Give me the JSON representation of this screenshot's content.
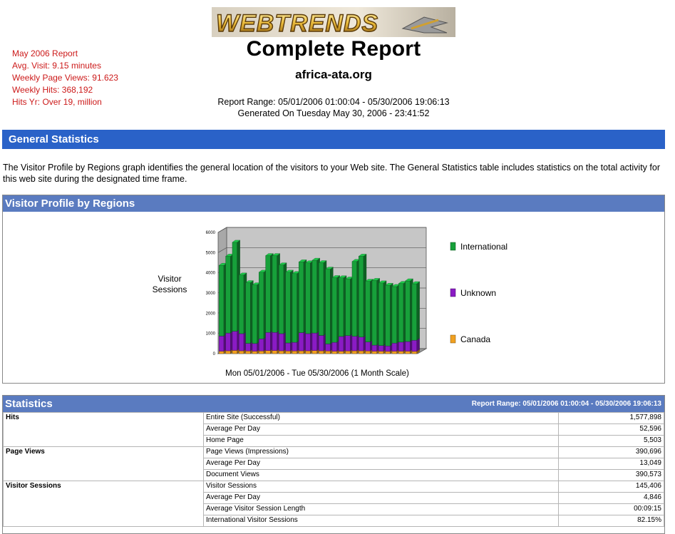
{
  "header": {
    "logo_text": "WEBTRENDS",
    "title": "Complete Report",
    "domain": "africa-ata.org",
    "report_range": "Report Range: 05/01/2006 01:00:04 - 05/30/2006 19:06:13",
    "generated_on": "Generated On Tuesday May 30, 2006 - 23:41:52"
  },
  "side_notes": [
    "May 2006 Report",
    "Avg. Visit: 9.15 minutes",
    "Weekly Page Views: 91.623",
    "Weekly Hits: 368,192",
    "Hits Yr: Over 19, million"
  ],
  "general": {
    "title": "General Statistics",
    "intro": "The Visitor Profile by Regions graph identifies the general location of the visitors to your Web site. The General Statistics table includes statistics on the total activity for this web site during the designated time frame."
  },
  "chart_section": {
    "title": "Visitor Profile by Regions"
  },
  "chart_data": {
    "type": "bar",
    "stacked": true,
    "three_d": true,
    "ylabel": "Visitor Sessions",
    "xlabel": "Mon 05/01/2006 - Tue 05/30/2006 (1 Month Scale)",
    "ylim": [
      0,
      6000
    ],
    "yticks": [
      "0",
      "1000",
      "2000",
      "3000",
      "4000",
      "5000",
      "6000"
    ],
    "grid": true,
    "legend_position": "right",
    "series": [
      {
        "name": "International",
        "color": "#17a03a",
        "values": [
          3500,
          3800,
          4400,
          2900,
          3000,
          2900,
          3300,
          3800,
          3800,
          3400,
          3500,
          3400,
          3500,
          3500,
          3600,
          3600,
          3700,
          3200,
          2900,
          2800,
          3700,
          4000,
          3000,
          3200,
          3100,
          3000,
          2800,
          2900,
          3000,
          2800
        ]
      },
      {
        "name": "Unknown",
        "color": "#8a1bc4",
        "values": [
          750,
          880,
          950,
          850,
          380,
          380,
          600,
          900,
          900,
          850,
          400,
          430,
          900,
          850,
          870,
          760,
          350,
          440,
          730,
          760,
          720,
          680,
          450,
          300,
          280,
          270,
          400,
          450,
          480,
          550
        ]
      },
      {
        "name": "Canada",
        "color": "#f0a020",
        "values": [
          120,
          140,
          160,
          140,
          130,
          120,
          130,
          150,
          150,
          140,
          130,
          130,
          140,
          140,
          150,
          140,
          130,
          120,
          120,
          130,
          140,
          140,
          130,
          120,
          120,
          110,
          120,
          120,
          120,
          110
        ]
      }
    ]
  },
  "stats": {
    "title": "Statistics",
    "range": "Report Range: 05/01/2006 01:00:04 - 05/30/2006 19:06:13",
    "groups": [
      {
        "name": "Hits",
        "rows": [
          {
            "label": "Entire Site (Successful)",
            "value": "1,577,898"
          },
          {
            "label": "Average Per Day",
            "value": "52,596"
          },
          {
            "label": "Home Page",
            "value": "5,503"
          }
        ]
      },
      {
        "name": "Page Views",
        "rows": [
          {
            "label": "Page Views (Impressions)",
            "value": "390,696"
          },
          {
            "label": "Average Per Day",
            "value": "13,049"
          },
          {
            "label": "Document Views",
            "value": "390,573"
          }
        ]
      },
      {
        "name": "Visitor Sessions",
        "rows": [
          {
            "label": "Visitor Sessions",
            "value": "145,406"
          },
          {
            "label": "Average Per Day",
            "value": "4,846"
          },
          {
            "label": "Average Visitor Session Length",
            "value": "00:09:15"
          },
          {
            "label": "International Visitor Sessions",
            "value": "82.15%"
          }
        ]
      }
    ]
  }
}
